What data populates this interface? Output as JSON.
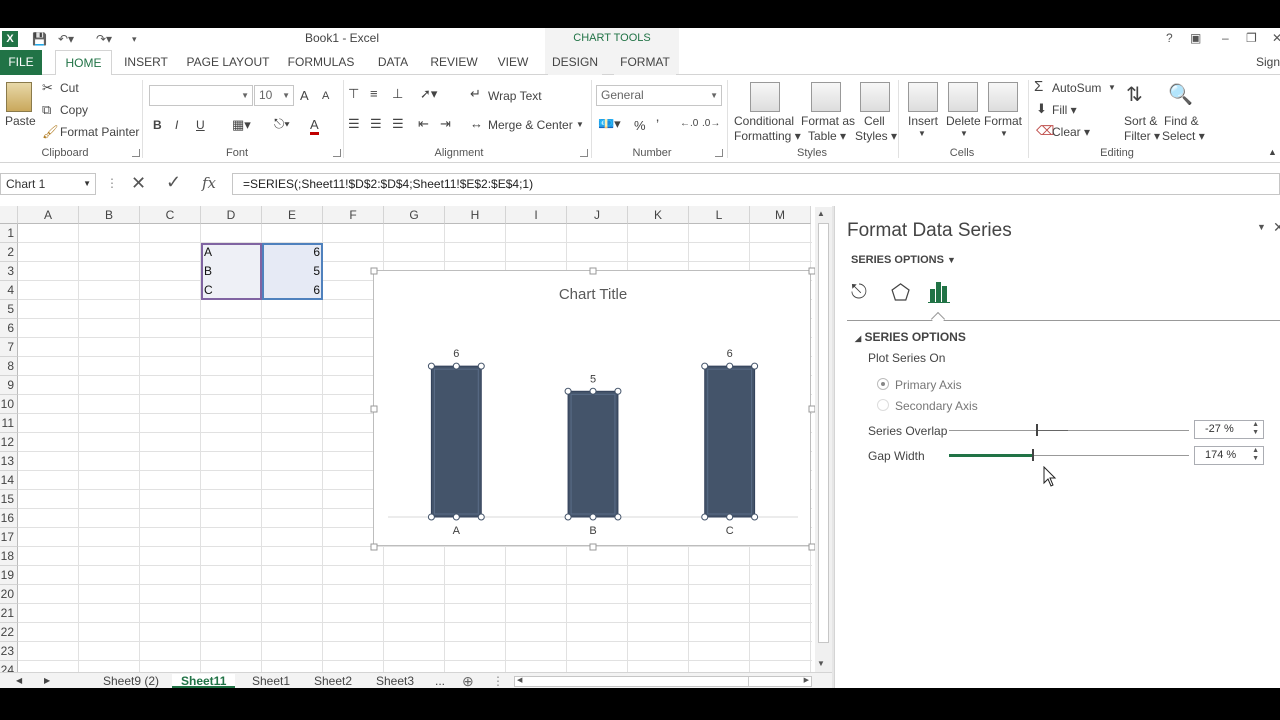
{
  "window": {
    "app_icon": "X",
    "title": "Book1 - Excel",
    "context_group": "CHART TOOLS",
    "help": "?",
    "account": "Sign"
  },
  "tabs": [
    {
      "label": "FILE"
    },
    {
      "label": "HOME"
    },
    {
      "label": "INSERT"
    },
    {
      "label": "PAGE LAYOUT"
    },
    {
      "label": "FORMULAS"
    },
    {
      "label": "DATA"
    },
    {
      "label": "REVIEW"
    },
    {
      "label": "VIEW"
    },
    {
      "label": "DESIGN"
    },
    {
      "label": "FORMAT"
    }
  ],
  "ribbon": {
    "clipboard": {
      "paste": "Paste",
      "cut": "Cut",
      "copy": "Copy",
      "format_painter": "Format Painter",
      "label": "Clipboard"
    },
    "font": {
      "size": "10",
      "bold": "B",
      "italic": "I",
      "underline": "U",
      "grow": "A",
      "shrink": "A",
      "color": "A",
      "label": "Font"
    },
    "alignment": {
      "wrap": "Wrap Text",
      "merge": "Merge & Center",
      "label": "Alignment"
    },
    "number": {
      "format": "General",
      "percent": "%",
      "comma": "’",
      "label": "Number"
    },
    "styles": {
      "conditional_1": "Conditional",
      "conditional_2": "Formatting",
      "table_1": "Format as",
      "table_2": "Table",
      "cell_1": "Cell",
      "cell_2": "Styles",
      "label": "Styles"
    },
    "cells": {
      "insert": "Insert",
      "delete": "Delete",
      "format": "Format",
      "label": "Cells"
    },
    "editing": {
      "autosum": "AutoSum",
      "fill": "Fill",
      "clear": "Clear",
      "sort_1": "Sort &",
      "sort_2": "Filter",
      "find_1": "Find &",
      "find_2": "Select",
      "label": "Editing"
    }
  },
  "formula_bar": {
    "name_box": "Chart 1",
    "fx": "fx",
    "formula": "=SERIES(;Sheet11!$D$2:$D$4;Sheet11!$E$2:$E$4;1)"
  },
  "grid": {
    "columns": [
      "A",
      "B",
      "C",
      "D",
      "E",
      "F",
      "G",
      "H",
      "I",
      "J",
      "K",
      "L",
      "M"
    ],
    "rows": [
      "1",
      "2",
      "3",
      "4",
      "5",
      "6",
      "7",
      "8",
      "9",
      "10",
      "11",
      "12",
      "13",
      "14",
      "15",
      "16",
      "17",
      "18",
      "19",
      "20",
      "21",
      "22",
      "23",
      "24"
    ],
    "cells": [
      {
        "label": "A",
        "value": "6"
      },
      {
        "label": "B",
        "value": "5"
      },
      {
        "label": "C",
        "value": "6"
      }
    ]
  },
  "chart_data": {
    "type": "bar",
    "title": "Chart Title",
    "categories": [
      "A",
      "B",
      "C"
    ],
    "values": [
      6,
      5,
      6
    ],
    "data_labels": [
      "6",
      "5",
      "6"
    ],
    "ylim": [
      0,
      7
    ],
    "legend": "none",
    "gridlines": false,
    "bar_color": "#44546a"
  },
  "sheets": [
    "Sheet9 (2)",
    "Sheet11",
    "Sheet1",
    "Sheet2",
    "Sheet3",
    "..."
  ],
  "active_sheet": "Sheet11",
  "pane": {
    "title": "Format Data Series",
    "menu": "SERIES OPTIONS",
    "section": "SERIES OPTIONS",
    "plot_on": "Plot Series On",
    "primary": "Primary Axis",
    "secondary": "Secondary Axis",
    "overlap_label": "Series Overlap",
    "overlap_value": "-27 %",
    "overlap": -27,
    "gap_label": "Gap Width",
    "gap_value": "174 %",
    "gap": 174
  },
  "colors": {
    "accent": "#217346",
    "bar": "#44546a"
  }
}
